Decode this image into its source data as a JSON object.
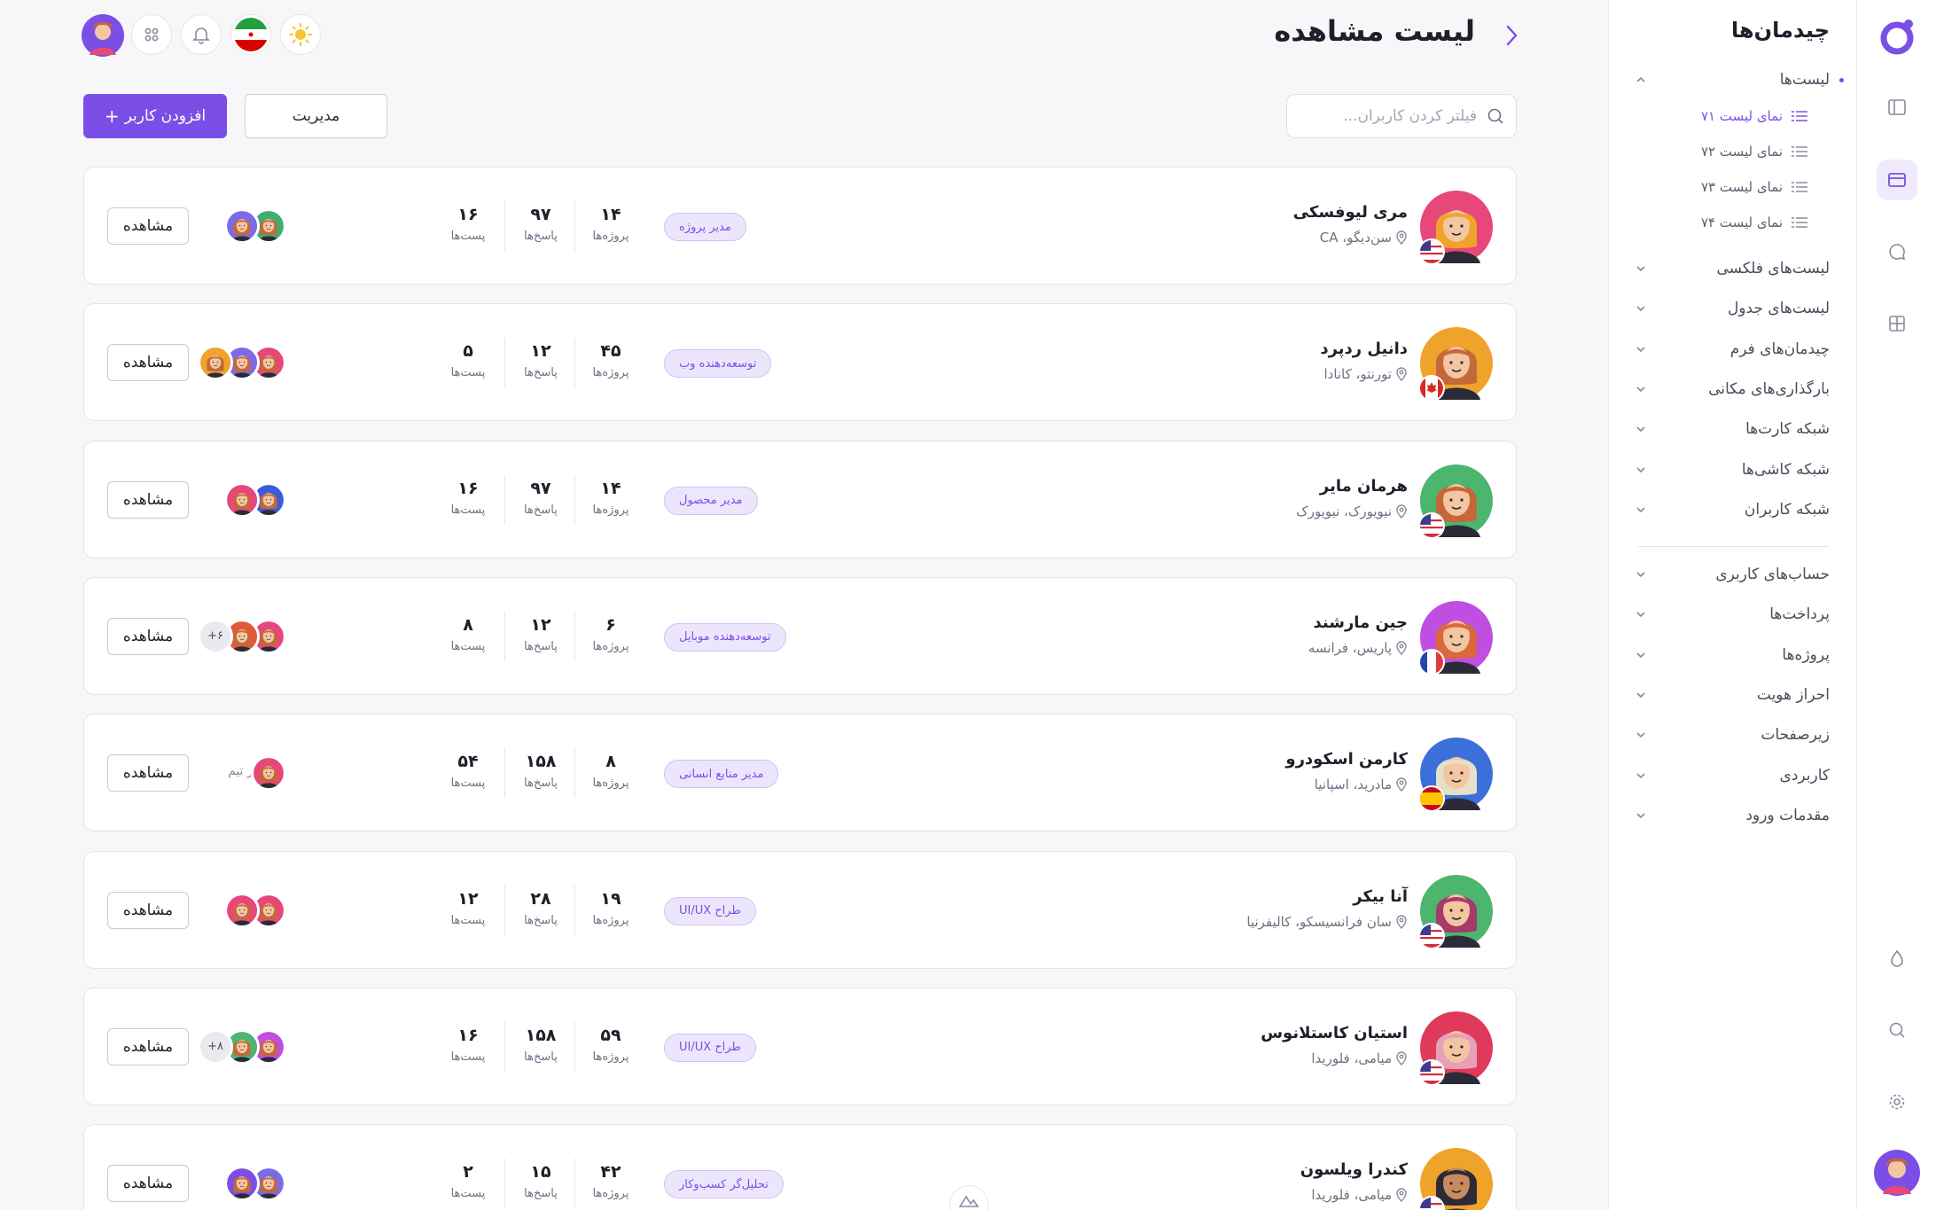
{
  "page": {
    "title": "لیست مشاهده",
    "search_placeholder": "فیلتر کردن کاربران...",
    "manage_label": "مدیریت",
    "add_user_label": "افزودن کاربر"
  },
  "sidebar": {
    "title": "چیدمان‌ها",
    "lists_label": "لیست‌ها",
    "subitems": [
      "نمای لیست ۷۱",
      "نمای لیست ۷۲",
      "نمای لیست ۷۳",
      "نمای لیست ۷۴"
    ],
    "groups": [
      "لیست‌های فلکسی",
      "لیست‌های جدول",
      "چیدمان‌های فرم",
      "بارگذاری‌های مکانی",
      "شبکه کارت‌ها",
      "شبکه کاشی‌ها",
      "شبکه کاربران"
    ],
    "groups2": [
      "حساب‌های کاربری",
      "پرداخت‌ها",
      "پروژه‌ها",
      "احراز هویت",
      "زیرصفحات",
      "کاربردی",
      "مقدمات ورود"
    ]
  },
  "labels": {
    "projects": "پروژه‌ها",
    "replies": "پاسخ‌ها",
    "posts": "پست‌ها",
    "in_team": "در تیم",
    "view": "مشاهده"
  },
  "colors": {
    "accent": "#7b4fe6",
    "badge_bg": "#ece6fc"
  },
  "users": [
    {
      "name": "مری لیوفسکی",
      "location": "سن‌دیگو، CA",
      "role": "مدیر پروژه",
      "projects": "۱۴",
      "replies": "۹۷",
      "posts": "۱۶",
      "team_more": "",
      "flag": "us",
      "avatar_bg": "#e8477a",
      "hair": "#f0a32b",
      "skin": "#f3c6a1",
      "team": [
        "#7b6be6",
        "#3fae6f"
      ]
    },
    {
      "name": "دانیل ردپرد",
      "location": "تورنتو، کانادا",
      "role": "توسعه‌دهنده وب",
      "projects": "۴۵",
      "replies": "۱۲",
      "posts": "۵",
      "team_more": "",
      "flag": "ca",
      "avatar_bg": "#f0a32b",
      "hair": "#c4683a",
      "skin": "#f3c6a1",
      "team": [
        "#f0a32b",
        "#7b6be6",
        "#e8477a"
      ]
    },
    {
      "name": "هرمان مایر",
      "location": "نیویورک، نیویورک",
      "role": "مدیر محصول",
      "projects": "۱۴",
      "replies": "۹۷",
      "posts": "۱۶",
      "team_more": "",
      "flag": "us",
      "avatar_bg": "#4cb56e",
      "hair": "#c4683a",
      "skin": "#f3c6a1",
      "team": [
        "#e8477a",
        "#3b5bdb"
      ]
    },
    {
      "name": "جین مارشند",
      "location": "پاریس، فرانسه",
      "role": "توسعه‌دهنده موبایل",
      "projects": "۶",
      "replies": "۱۲",
      "posts": "۸",
      "team_more": "+۶",
      "flag": "fr",
      "avatar_bg": "#c04ee0",
      "hair": "#d9693c",
      "skin": "#f3c6a1",
      "team": [
        "#e05a3a",
        "#e8477a"
      ]
    },
    {
      "name": "کارمن اسکودرو",
      "location": "مادرید، اسپانیا",
      "role": "مدیر منابع انسانی",
      "projects": "۸",
      "replies": "۱۵۸",
      "posts": "۵۴",
      "team_more": "",
      "flag": "es",
      "avatar_bg": "#3b6fd9",
      "hair": "#e6e0c8",
      "skin": "#f3c6a1",
      "team": [
        "#e8477a"
      ]
    },
    {
      "name": "آنا بیکر",
      "location": "سان فرانسیسکو، کالیفرنیا",
      "role": "طراح UI/UX",
      "projects": "۱۹",
      "replies": "۲۸",
      "posts": "۱۲",
      "team_more": "",
      "flag": "us",
      "avatar_bg": "#4cb56e",
      "hair": "#a63a6a",
      "skin": "#f3c6a1",
      "team": [
        "#e8477a",
        "#e8477a"
      ]
    },
    {
      "name": "استیان کاستلانوس",
      "location": "میامی، فلوریدا",
      "role": "طراح UI/UX",
      "projects": "۵۹",
      "replies": "۱۵۸",
      "posts": "۱۶",
      "team_more": "+۸",
      "flag": "us",
      "avatar_bg": "#e03a5a",
      "hair": "#e6a0b8",
      "skin": "#f3c6a1",
      "team": [
        "#4cb56e",
        "#c04ee0"
      ]
    },
    {
      "name": "کندرا ویلسون",
      "location": "میامی، فلوریدا",
      "role": "تحلیل‌گر کسب‌وکار",
      "projects": "۴۲",
      "replies": "۱۵",
      "posts": "۲",
      "team_more": "",
      "flag": "us",
      "avatar_bg": "#f0a32b",
      "hair": "#2b2b38",
      "skin": "#c98a5e",
      "team": [
        "#7b4fe6",
        "#7b6be6"
      ]
    }
  ]
}
